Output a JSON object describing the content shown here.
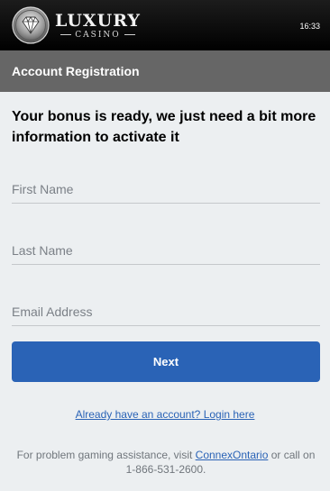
{
  "header": {
    "brand_name": "LUXURY",
    "brand_sub": "CASINO",
    "time": "16:33"
  },
  "title_bar": {
    "title": "Account Registration"
  },
  "main": {
    "heading": "Your bonus is ready, we just need a bit more information to activate it",
    "first_name_placeholder": "First Name",
    "last_name_placeholder": "Last Name",
    "email_placeholder": "Email Address",
    "next_label": "Next",
    "login_link": "Already have an account? Login here"
  },
  "footer": {
    "prefix": "For problem gaming assistance, visit ",
    "link": "ConnexOntario",
    "suffix": " or call on 1-866-531-2600."
  },
  "colors": {
    "header_bg": "#000000",
    "title_bar_bg": "#666666",
    "page_bg": "#eceff1",
    "accent": "#2a63b6"
  },
  "icons": {
    "logo_emblem": "diamond-emblem-icon"
  }
}
